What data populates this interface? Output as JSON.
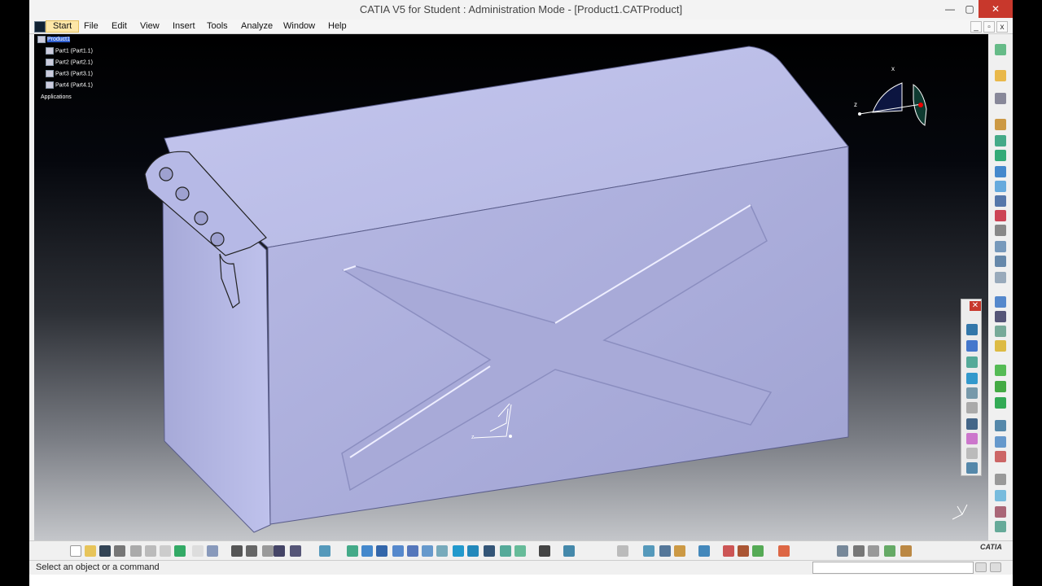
{
  "window": {
    "title": "CATIA V5 for Student : Administration Mode - [Product1.CATProduct]",
    "controls": {
      "minimize": "—",
      "maximize": "▢",
      "close": "✕"
    },
    "mdi_controls": {
      "minimize": "_",
      "restore": "▫",
      "close": "x"
    }
  },
  "menu": {
    "start": "Start",
    "items": [
      "File",
      "Edit",
      "View",
      "Insert",
      "Tools",
      "Analyze",
      "Window",
      "Help"
    ]
  },
  "tree": {
    "root": "Product1",
    "parts": [
      "Part1 (Part1.1)",
      "Part2 (Part2.1)",
      "Part3 (Part3.1)",
      "Part4 (Part4.1)"
    ],
    "applications": "Applications"
  },
  "compass": {
    "x_label": "x",
    "z_label": "z"
  },
  "model_axis": {
    "label": "z"
  },
  "status": {
    "message": "Select an object or a command"
  },
  "logo": {
    "text": "CATIA"
  },
  "colors": {
    "model_face_top": "#b9bce6",
    "model_face_front": "#a9abd8",
    "model_face_side": "#9a9dcc",
    "accent_red": "#c8382c"
  }
}
